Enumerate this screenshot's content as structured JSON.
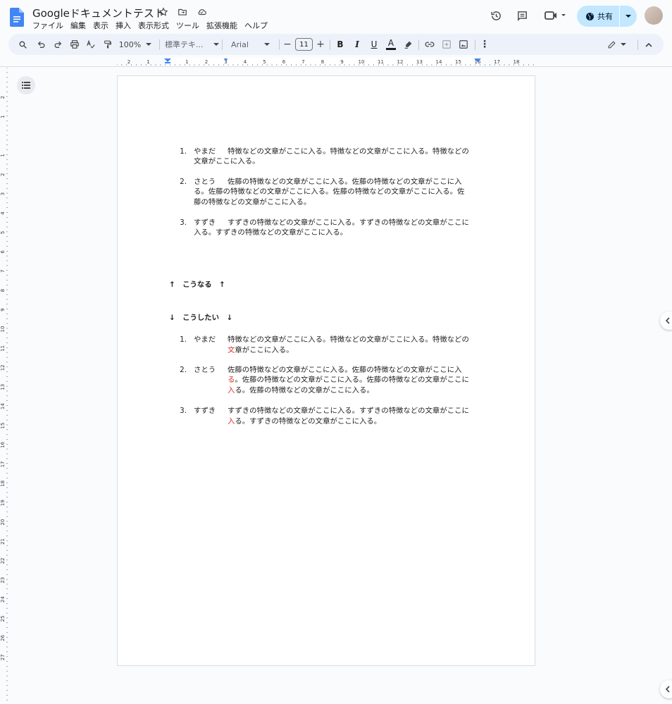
{
  "header": {
    "title": "Googleドキュメントテスト",
    "menus": [
      "ファイル",
      "編集",
      "表示",
      "挿入",
      "表示形式",
      "ツール",
      "拡張機能",
      "ヘルプ"
    ],
    "share_label": "共有",
    "title_icons": [
      "star-icon",
      "move-folder-icon",
      "cloud-status-icon"
    ],
    "right_icons": [
      "history-icon",
      "comment-icon",
      "meet-icon"
    ]
  },
  "toolbar": {
    "zoom": "100%",
    "style": "標準テキ...",
    "font": "Arial",
    "font_size": "11",
    "minus": "−",
    "plus": "+",
    "bold": "B",
    "italic": "I",
    "underline": "U",
    "text_color": "A",
    "more": "⋮"
  },
  "ruler": {
    "labels": [
      "2",
      "1",
      "1",
      "2",
      "3",
      "4",
      "5",
      "6",
      "7",
      "8",
      "9",
      "10",
      "11",
      "12",
      "13",
      "14",
      "15",
      "16",
      "17",
      "18"
    ]
  },
  "vruler": {
    "labels": [
      "2",
      "1",
      "1",
      "2",
      "3",
      "4",
      "5",
      "6",
      "7",
      "8",
      "9",
      "10",
      "11",
      "12",
      "13",
      "14",
      "15",
      "16",
      "17",
      "18",
      "19",
      "20",
      "21",
      "22",
      "23",
      "24",
      "25",
      "26",
      "27"
    ]
  },
  "doc": {
    "list1": [
      {
        "num": "1.",
        "name": "やまだ",
        "lines": [
          "特徴などの文章がここに入る。特徴などの文章がここに入る。特徴などの",
          "文章がここに入る。"
        ]
      },
      {
        "num": "2.",
        "name": "さとう",
        "lines": [
          "佐藤の特徴などの文章がここに入る。佐藤の特徴などの文章がここに入",
          "る。佐藤の特徴などの文章がここに入る。佐藤の特徴などの文章がここに入る。佐",
          "藤の特徴などの文章がここに入る。"
        ]
      },
      {
        "num": "3.",
        "name": "すずき",
        "lines": [
          "すずきの特徴などの文章がここに入る。すずきの特徴などの文章がここに",
          "入る。すずきの特徴などの文章がここに入る。"
        ]
      }
    ],
    "heading1": "↑　こうなる　↑",
    "heading2": "↓　こうしたい　↓",
    "list2": [
      {
        "num": "1.",
        "name": "やまだ",
        "lines": [
          {
            "red": "",
            "rest": "特徴などの文章がここに入る。特徴などの文章がここに入る。特徴などの"
          },
          {
            "red": "文",
            "rest": "章がここに入る。"
          }
        ]
      },
      {
        "num": "2.",
        "name": "さとう",
        "lines": [
          {
            "red": "",
            "rest": "佐藤の特徴などの文章がここに入る。佐藤の特徴などの文章がここに入"
          },
          {
            "red": "る",
            "rest": "。佐藤の特徴などの文章がここに入る。佐藤の特徴などの文章がここに"
          },
          {
            "red": "入",
            "rest": "る。佐藤の特徴などの文章がここに入る。"
          }
        ]
      },
      {
        "num": "3.",
        "name": "すずき",
        "lines": [
          {
            "red": "",
            "rest": "すずきの特徴などの文章がここに入る。すずきの特徴などの文章がここに"
          },
          {
            "red": "入",
            "rest": "る。すずきの特徴などの文章がここに入る。"
          }
        ]
      }
    ]
  },
  "colors": {
    "accent": "#1a73e8",
    "share_bg": "#c2e7ff",
    "toolbar_bg": "#edf2fa",
    "highlight_red": "#d93025"
  }
}
